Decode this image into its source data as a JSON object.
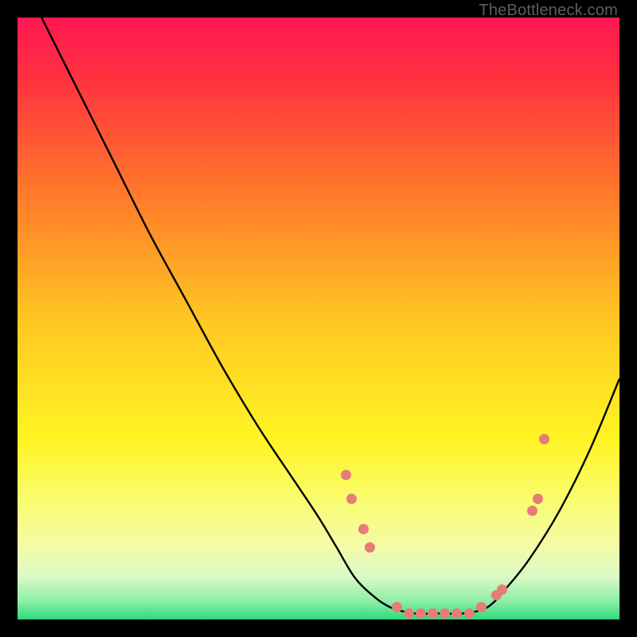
{
  "watermark": "TheBottleneck.com",
  "colors": {
    "background": "#000000",
    "curve": "#000000",
    "point_fill": "#e77c77",
    "watermark": "#5d5d5d",
    "gradient_stops": [
      {
        "offset": 0.0,
        "color": "#ff1752"
      },
      {
        "offset": 0.1,
        "color": "#ff313f"
      },
      {
        "offset": 0.3,
        "color": "#ff7c2a"
      },
      {
        "offset": 0.5,
        "color": "#ffc622"
      },
      {
        "offset": 0.7,
        "color": "#fff423"
      },
      {
        "offset": 0.8,
        "color": "#fafc6e"
      },
      {
        "offset": 0.88,
        "color": "#f3fba8"
      },
      {
        "offset": 0.93,
        "color": "#d9f9c7"
      },
      {
        "offset": 0.97,
        "color": "#8ceea6"
      },
      {
        "offset": 1.0,
        "color": "#2fd97c"
      }
    ]
  },
  "chart_data": {
    "type": "line",
    "title": "",
    "xlabel": "",
    "ylabel": "",
    "xlim": [
      0,
      100
    ],
    "ylim": [
      0,
      100
    ],
    "grid": false,
    "legend": false,
    "series": [
      {
        "name": "bottleneck-curve",
        "x": [
          4,
          10,
          16,
          22,
          28,
          34,
          40,
          46,
          50,
          53,
          56,
          59,
          62,
          66,
          70,
          74,
          78,
          81,
          85,
          90,
          95,
          100
        ],
        "y": [
          100,
          88,
          76,
          64,
          53,
          42,
          32,
          23,
          17,
          12,
          7,
          4,
          2,
          1,
          1,
          1,
          2,
          5,
          10,
          18,
          28,
          40
        ]
      }
    ],
    "points": [
      {
        "name": "p1",
        "x": 54.5,
        "y": 24
      },
      {
        "name": "p2",
        "x": 55.5,
        "y": 20
      },
      {
        "name": "p3",
        "x": 57.5,
        "y": 15
      },
      {
        "name": "p4",
        "x": 58.5,
        "y": 12
      },
      {
        "name": "p5",
        "x": 63.0,
        "y": 2
      },
      {
        "name": "p6",
        "x": 65.0,
        "y": 1
      },
      {
        "name": "p7",
        "x": 67.0,
        "y": 1
      },
      {
        "name": "p8",
        "x": 69.0,
        "y": 1
      },
      {
        "name": "p9",
        "x": 71.0,
        "y": 1
      },
      {
        "name": "p10",
        "x": 73.0,
        "y": 1
      },
      {
        "name": "p11",
        "x": 75.0,
        "y": 1
      },
      {
        "name": "p12",
        "x": 77.0,
        "y": 2
      },
      {
        "name": "p13",
        "x": 79.5,
        "y": 4
      },
      {
        "name": "p14",
        "x": 80.5,
        "y": 5
      },
      {
        "name": "p15",
        "x": 85.5,
        "y": 18
      },
      {
        "name": "p16",
        "x": 86.5,
        "y": 20
      },
      {
        "name": "p17",
        "x": 87.5,
        "y": 30
      }
    ]
  }
}
